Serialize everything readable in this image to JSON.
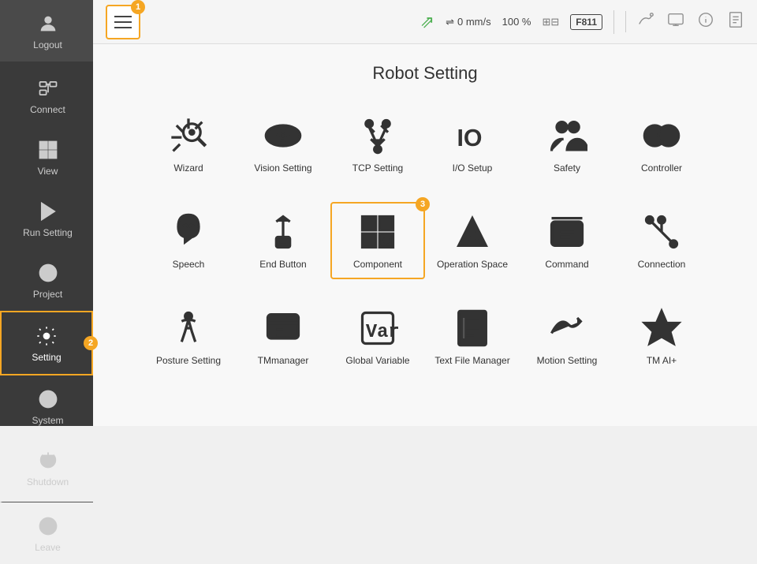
{
  "sidebar": {
    "items": [
      {
        "id": "logout",
        "label": "Logout"
      },
      {
        "id": "connect",
        "label": "Connect"
      },
      {
        "id": "view",
        "label": "View"
      },
      {
        "id": "run-setting",
        "label": "Run Setting"
      },
      {
        "id": "project",
        "label": "Project"
      },
      {
        "id": "setting",
        "label": "Setting"
      },
      {
        "id": "system",
        "label": "System"
      },
      {
        "id": "shutdown",
        "label": "Shutdown"
      },
      {
        "id": "leave",
        "label": "Leave"
      }
    ]
  },
  "topbar": {
    "menu_badge": "1",
    "speed": "0 mm/s",
    "percent": "100 %",
    "f_code": "F811"
  },
  "page": {
    "title": "Robot Setting"
  },
  "grid": {
    "rows": [
      [
        {
          "id": "wizard",
          "label": "Wizard"
        },
        {
          "id": "vision-setting",
          "label": "Vision Setting"
        },
        {
          "id": "tcp-setting",
          "label": "TCP Setting"
        },
        {
          "id": "io-setup",
          "label": "I/O Setup"
        },
        {
          "id": "safety",
          "label": "Safety"
        },
        {
          "id": "controller",
          "label": "Controller"
        }
      ],
      [
        {
          "id": "speech",
          "label": "Speech"
        },
        {
          "id": "end-button",
          "label": "End Button"
        },
        {
          "id": "component",
          "label": "Component",
          "selected": true,
          "badge": "3"
        },
        {
          "id": "operation-space",
          "label": "Operation Space"
        },
        {
          "id": "command",
          "label": "Command"
        },
        {
          "id": "connection",
          "label": "Connection"
        }
      ],
      [
        {
          "id": "posture-setting",
          "label": "Posture Setting"
        },
        {
          "id": "tmmanager",
          "label": "TMmanager"
        },
        {
          "id": "global-variable",
          "label": "Global Variable"
        },
        {
          "id": "text-file-manager",
          "label": "Text File Manager"
        },
        {
          "id": "motion-setting",
          "label": "Motion Setting"
        },
        {
          "id": "tm-ai-plus",
          "label": "TM AI+"
        }
      ]
    ]
  }
}
